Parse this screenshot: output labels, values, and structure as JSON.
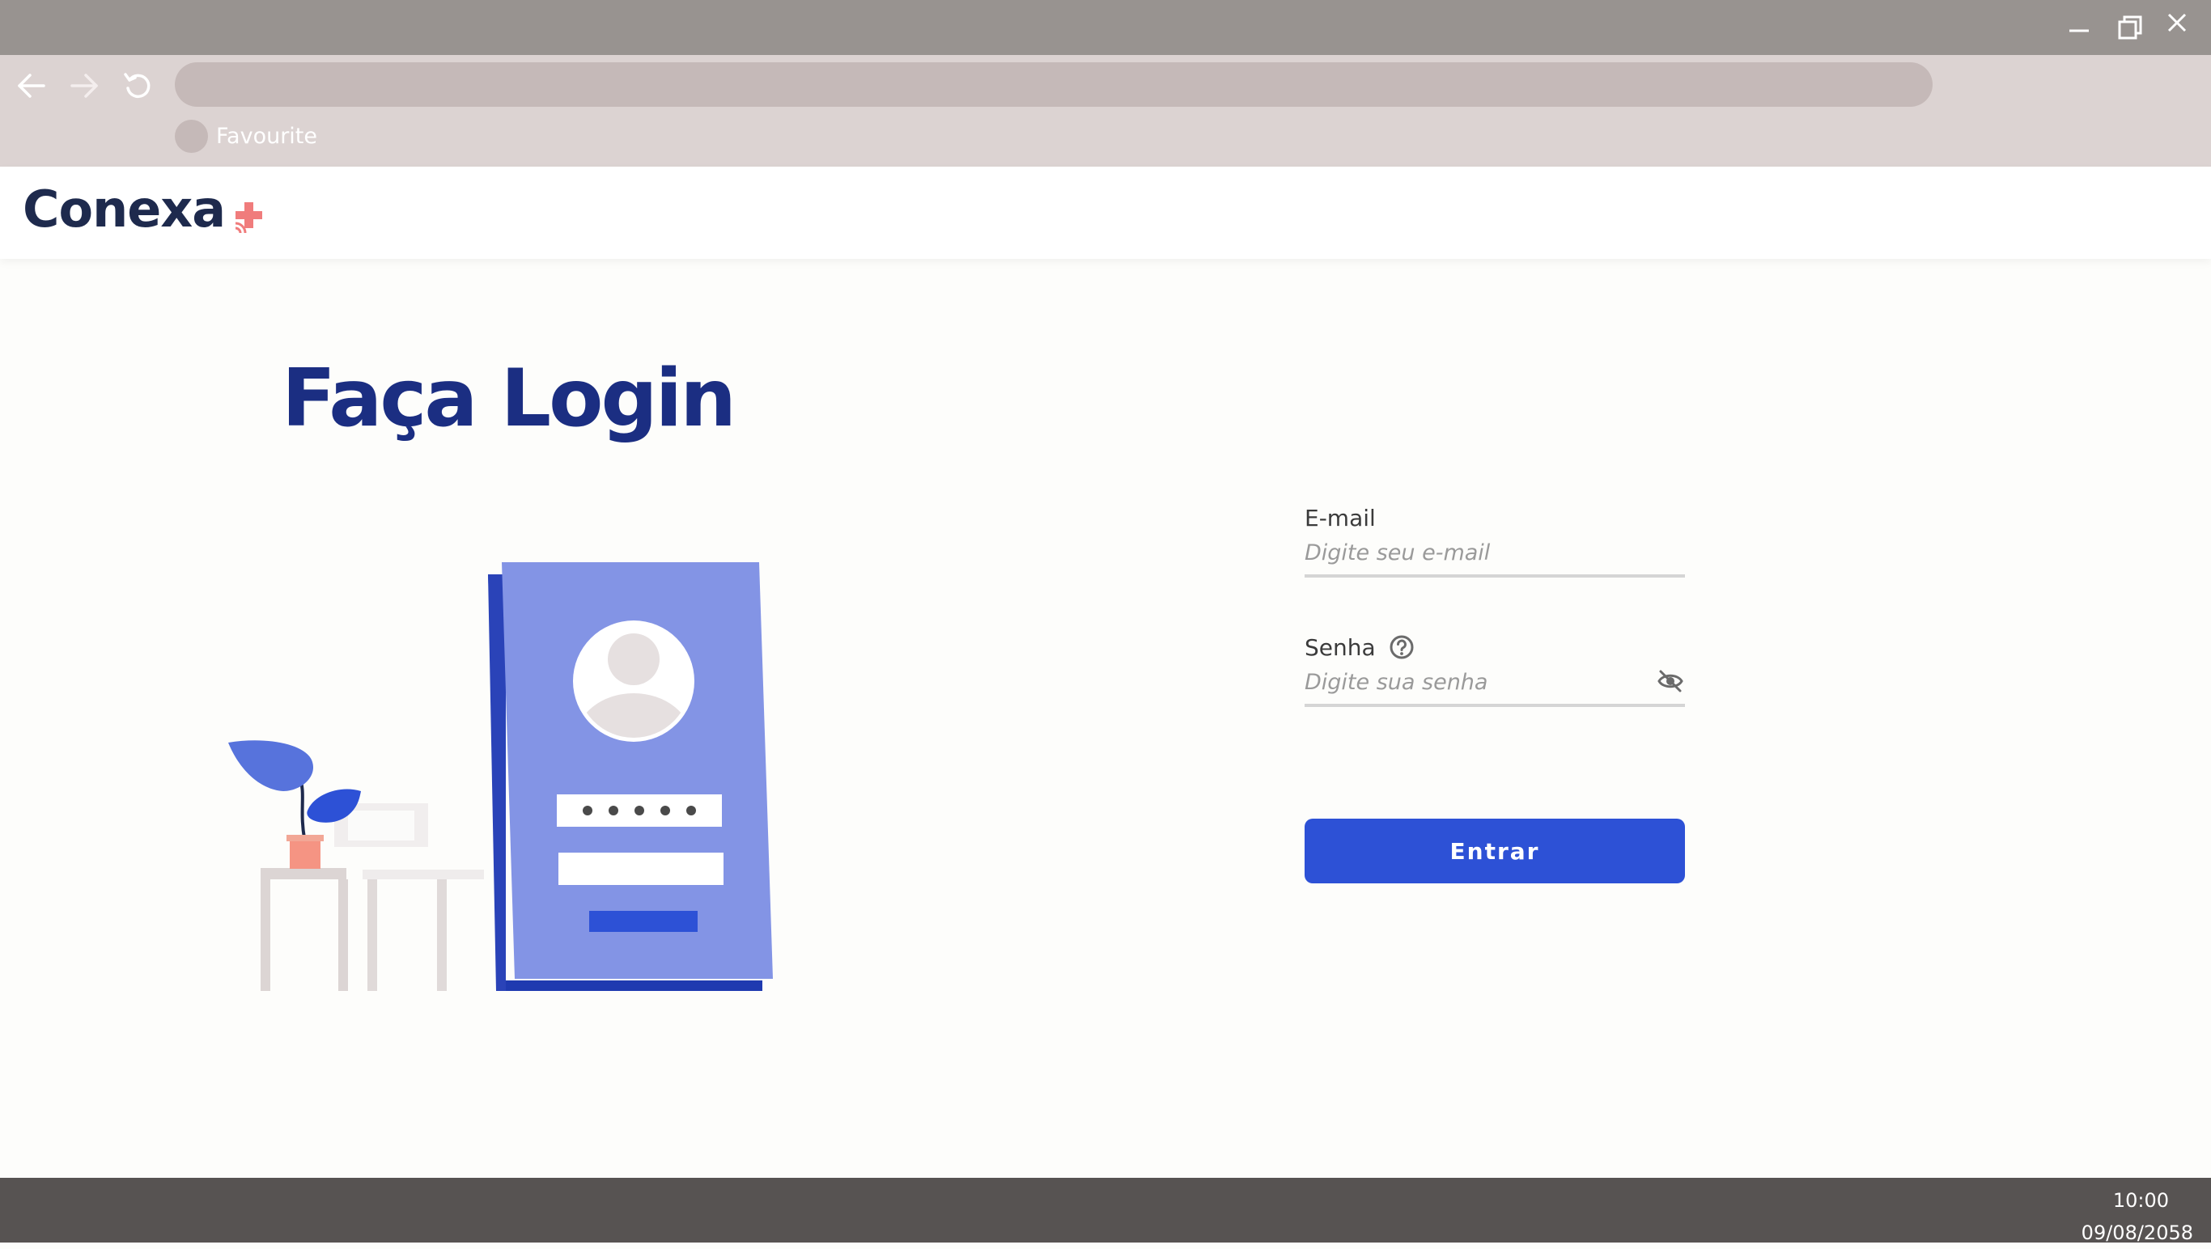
{
  "browser": {
    "bookmarks": [
      {
        "label": "Favourite"
      }
    ]
  },
  "site": {
    "logo_text": "Conexa",
    "title": "Faça Login"
  },
  "form": {
    "email": {
      "label": "E-mail",
      "placeholder": "Digite seu e-mail",
      "value": ""
    },
    "password": {
      "label": "Senha",
      "placeholder": "Digite sua senha",
      "value": ""
    },
    "submit_label": "Entrar"
  },
  "taskbar": {
    "time": "10:00",
    "date": "09/08/2058"
  },
  "colors": {
    "brand_navy": "#1e2a4d",
    "title_blue": "#1b2e82",
    "primary_button": "#2d51d6",
    "logo_accent": "#f07c7c",
    "titlebar": "#989390",
    "toolbar": "#dcd3d2",
    "taskbar": "#575352"
  },
  "icons": {
    "minimize": "minimize-icon",
    "restore": "restore-icon",
    "close": "close-icon",
    "back": "arrow-left-icon",
    "forward": "arrow-right-icon",
    "reload": "reload-icon",
    "help": "question-circle-icon",
    "password_toggle": "eye-off-icon"
  }
}
